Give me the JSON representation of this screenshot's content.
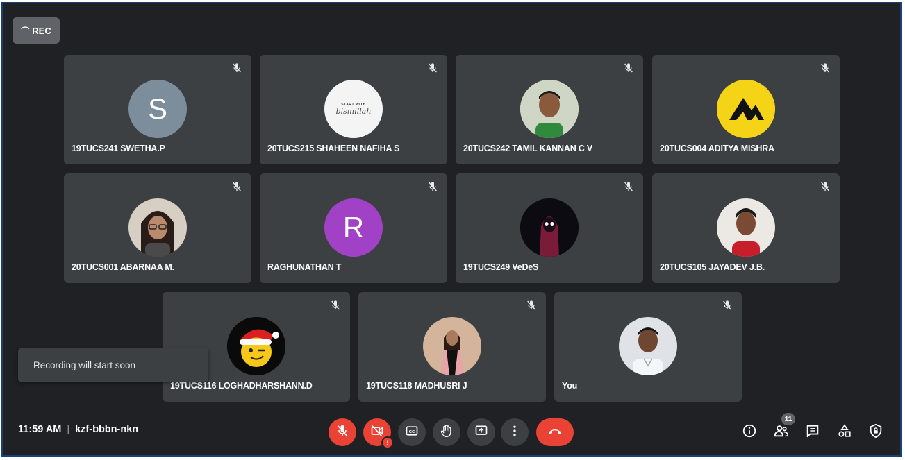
{
  "rec_button": {
    "label": "REC"
  },
  "participants": [
    {
      "name": "19TUCS241 SWETHA.P",
      "avatar_letter": "S",
      "avatar_color": "#7c8d9b",
      "muted": true
    },
    {
      "name": "20TUCS215 SHAHEEN NAFIHA S",
      "avatar_letter": "",
      "avatar_color": "#f4f4f4",
      "avatar_caption_top": "START WITH",
      "avatar_caption": "bismillah",
      "muted": true
    },
    {
      "name": "20TUCS242 TAMIL KANNAN C V",
      "avatar_letter": "",
      "avatar_color": "#6f8a5a",
      "muted": true
    },
    {
      "name": "20TUCS004 ADITYA MISHRA",
      "avatar_letter": "",
      "avatar_color": "#f5d316",
      "muted": true
    },
    {
      "name": "20TUCS001 ABARNAA M.",
      "avatar_letter": "",
      "avatar_color": "#8a6a5a",
      "muted": true
    },
    {
      "name": "RAGHUNATHAN T",
      "avatar_letter": "R",
      "avatar_color": "#a142c6",
      "muted": true
    },
    {
      "name": "19TUCS249 VeDeS",
      "avatar_letter": "",
      "avatar_color": "#0d0b12",
      "muted": true
    },
    {
      "name": "20TUCS105 JAYADEV J.B.",
      "avatar_letter": "",
      "avatar_color": "#e9e6e2",
      "muted": true
    },
    {
      "name": "19TUCS116 LOGHADHARSHANN.D",
      "avatar_letter": "",
      "avatar_color": "#0a0a0a",
      "muted": true
    },
    {
      "name": "19TUCS118 MADHUSRI J",
      "avatar_letter": "",
      "avatar_color": "#c9a48a",
      "muted": true
    },
    {
      "name": "You",
      "avatar_letter": "",
      "avatar_color": "#d9dde2",
      "muted": true
    }
  ],
  "toast": {
    "text": "Recording will start soon"
  },
  "meeting": {
    "time": "11:59 AM",
    "separator": "|",
    "code": "kzf-bbbn-nkn"
  },
  "controls": {
    "mic": {
      "icon": "mic-off-icon",
      "state": "off"
    },
    "camera": {
      "icon": "camera-off-icon",
      "state": "off",
      "warning": "!"
    },
    "captions": {
      "icon": "captions-icon"
    },
    "hand": {
      "icon": "raise-hand-icon"
    },
    "present": {
      "icon": "present-icon"
    },
    "more": {
      "icon": "more-options-icon"
    },
    "hangup": {
      "icon": "hang-up-icon"
    }
  },
  "right_controls": {
    "info": {
      "icon": "info-icon"
    },
    "people": {
      "icon": "people-icon",
      "count": "11"
    },
    "chat": {
      "icon": "chat-icon"
    },
    "activities": {
      "icon": "activities-icon"
    },
    "host": {
      "icon": "host-controls-icon"
    }
  },
  "colors": {
    "background": "#202124",
    "tile": "#3c4043",
    "danger": "#ea4335",
    "control_gray": "#3c4043"
  }
}
